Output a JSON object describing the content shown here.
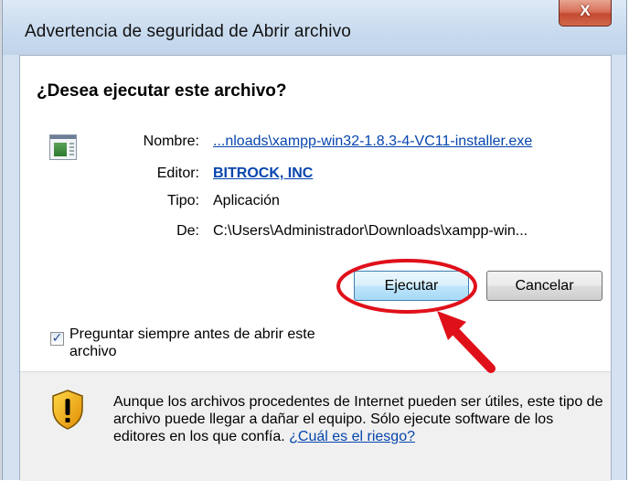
{
  "window": {
    "title": "Advertencia de seguridad de Abrir archivo",
    "close_glyph": "X"
  },
  "dialog": {
    "heading": "¿Desea ejecutar este archivo?",
    "file_icon": "executable-file-icon",
    "fields": {
      "name_label": "Nombre:",
      "name_value": "...nloads\\xampp-win32-1.8.3-4-VC11-installer.exe",
      "publisher_label": "Editor:",
      "publisher_value": "BITROCK, INC",
      "type_label": "Tipo:",
      "type_value": "Aplicación",
      "from_label": "De:",
      "from_value": "C:\\Users\\Administrador\\Downloads\\xampp-win..."
    },
    "buttons": {
      "run": "Ejecutar",
      "cancel": "Cancelar"
    },
    "checkbox": {
      "checked": true,
      "label": "Preguntar siempre antes de abrir este archivo"
    },
    "footer": {
      "icon": "shield-warning-icon",
      "text": "Aunque los archivos procedentes de Internet pueden ser útiles, este tipo de archivo puede llegar a dañar el equipo. Sólo ejecute software de los editores en los que confía.",
      "link": "¿Cuál es el riesgo?"
    }
  },
  "annotation": {
    "color": "#e0101a"
  }
}
